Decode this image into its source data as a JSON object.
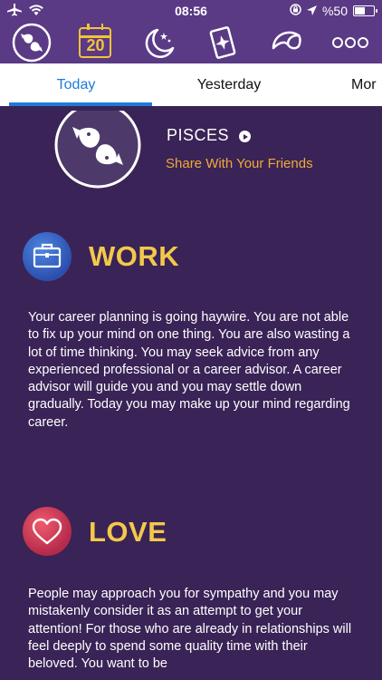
{
  "status_bar": {
    "time": "08:56",
    "battery_text": "%50",
    "battery_level": 0.5
  },
  "nav": {
    "icons": [
      "pisces-sign-icon",
      "calendar-icon",
      "moon-stars-icon",
      "tarot-card-icon",
      "fortune-cookie-icon",
      "more-icon"
    ],
    "calendar_day": "20"
  },
  "tabs": {
    "items": [
      "Today",
      "Yesterday",
      "Mor"
    ],
    "active": "Today"
  },
  "sign": {
    "name": "PISCES",
    "share_label": "Share With Your Friends"
  },
  "work": {
    "title": "WORK",
    "text": "Your career planning is going haywire. You are not able to fix up your mind on one thing. You are also wasting a lot of time thinking. You may seek advice from any experienced professional or a career advisor. A career advisor will guide you and you may settle down gradually. Today you may make up your mind regarding career."
  },
  "love": {
    "title": "LOVE",
    "text": "People may approach you for sympathy and you may mistakenly consider it as an attempt to get your attention! For those who are already in relationships will feel deeply to spend some quality time with their beloved. You want to be"
  },
  "colors": {
    "background": "#3a2356",
    "header": "#5a3a85",
    "accent_yellow": "#f4c84a",
    "accent_orange": "#f0a93a",
    "tab_active": "#1e7ad6"
  }
}
